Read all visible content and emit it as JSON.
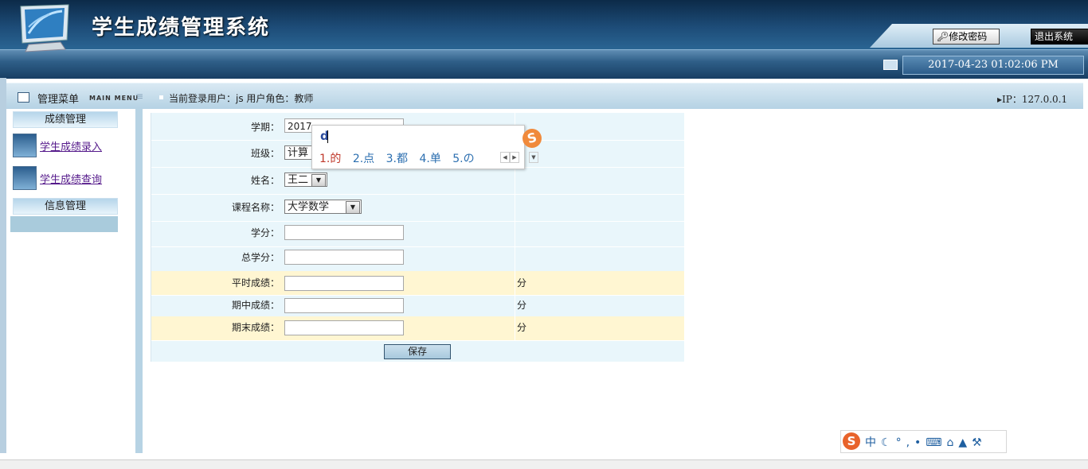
{
  "header": {
    "app_title": "学生成绩管理系统",
    "change_password_label": "修改密码",
    "logout_label": "退出系统",
    "datetime": "2017-04-23 01:02:06 PM"
  },
  "menubar": {
    "menu_title": "管理菜单",
    "menu_title_en": "MAIN MENU",
    "login_info": "当前登录用户：js 用户角色：教师",
    "ip_info": "IP：127.0.0.1"
  },
  "sidebar": {
    "section_grades": "成绩管理",
    "link_grade_entry": "学生成绩录入",
    "link_grade_query": "学生成绩查询",
    "section_info": "信息管理"
  },
  "form": {
    "term_label": "学期：",
    "term_value": "2017",
    "class_label": "班级：",
    "class_value": "计算",
    "name_label": "姓名：",
    "name_value": "王二",
    "course_label": "课程名称：",
    "course_value": "大学数学",
    "credit_label": "学分：",
    "total_credit_label": "总学分：",
    "usual_score_label": "平时成绩：",
    "midterm_score_label": "期中成绩：",
    "final_score_label": "期末成绩：",
    "unit": "分",
    "save_label": "保存"
  },
  "ime": {
    "composition": "d",
    "candidates": [
      "1.的",
      "2.点",
      "3.都",
      "4.单",
      "5.の"
    ],
    "toolbar_lang": "中"
  },
  "colors": {
    "header_dark": "#0c2a48",
    "menubar": "#b5d2e4",
    "form_bg": "#e9f6fb",
    "highlight_row": "#fff6d2",
    "link": "#551a8b"
  }
}
